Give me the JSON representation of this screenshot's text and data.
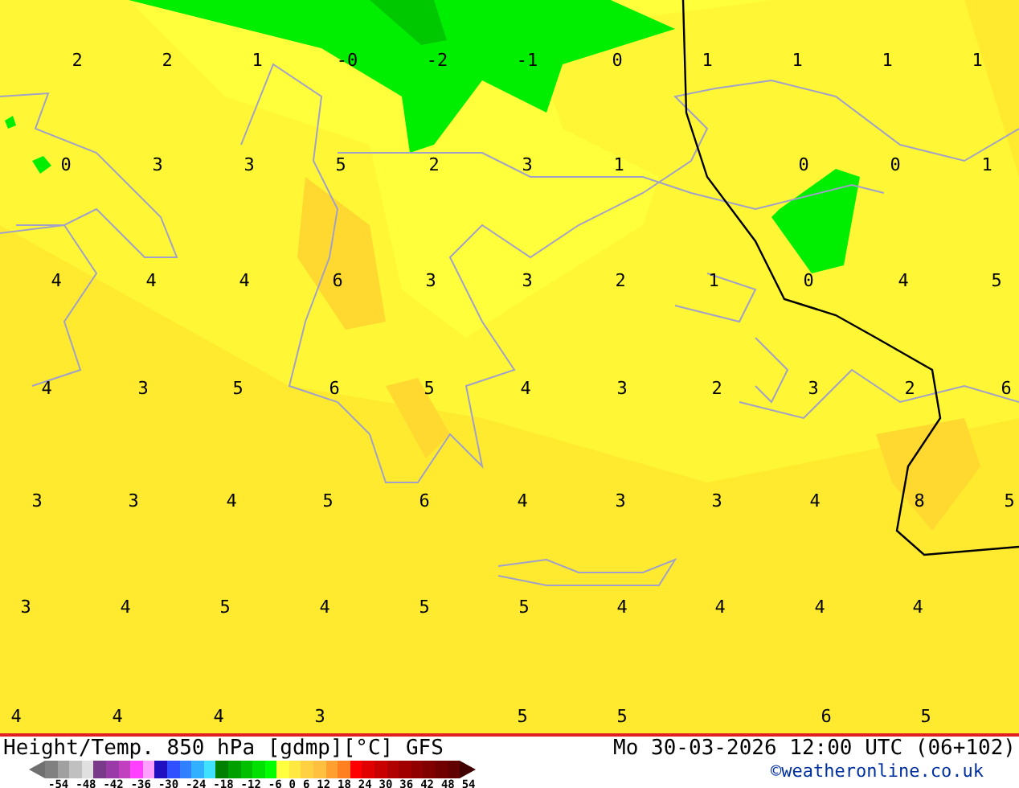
{
  "map": {
    "value_rows": [
      [
        "2",
        "2",
        "1",
        "-0",
        "-2",
        "-1",
        "0",
        "1",
        "1",
        "1",
        "1"
      ],
      [
        "0",
        "3",
        "3",
        "5",
        "2",
        "3",
        "1",
        "0",
        "0",
        "1"
      ],
      [
        "4",
        "4",
        "4",
        "6",
        "3",
        "3",
        "2",
        "1",
        "0",
        "4",
        "5"
      ],
      [
        "4",
        "3",
        "5",
        "6",
        "5",
        "4",
        "3",
        "2",
        "3",
        "2",
        "6"
      ],
      [
        "3",
        "3",
        "4",
        "5",
        "6",
        "4",
        "3",
        "3",
        "4",
        "8",
        "5"
      ],
      [
        "3",
        "4",
        "5",
        "4",
        "5",
        "5",
        "4",
        "4",
        "4",
        "4"
      ],
      [
        "4",
        "4",
        "4",
        "3",
        "5",
        "5",
        "6",
        "5"
      ]
    ]
  },
  "footer": {
    "title": "Height/Temp. 850 hPa [gdmp][°C] GFS",
    "datetime": "Mo 30-03-2026 12:00 UTC (06+102)",
    "credit": "©weatheronline.co.uk",
    "legend": {
      "swatches": [
        {
          "color": "#808080"
        },
        {
          "color": "#a0a0a0"
        },
        {
          "color": "#c0c0c0"
        },
        {
          "color": "#e0e0e0"
        },
        {
          "color": "#7a3a8a"
        },
        {
          "color": "#9a3aa8"
        },
        {
          "color": "#c040c0"
        },
        {
          "color": "#ff40ff"
        },
        {
          "color": "#ffa0ff"
        },
        {
          "color": "#2010c0"
        },
        {
          "color": "#3050ff"
        },
        {
          "color": "#3080ff"
        },
        {
          "color": "#30b0ff"
        },
        {
          "color": "#40e0ff"
        },
        {
          "color": "#008000"
        },
        {
          "color": "#00a000"
        },
        {
          "color": "#00c000"
        },
        {
          "color": "#00e000"
        },
        {
          "color": "#00ff00"
        },
        {
          "color": "#ffff40"
        },
        {
          "color": "#ffe840"
        },
        {
          "color": "#ffd040"
        },
        {
          "color": "#ffc040"
        },
        {
          "color": "#ffa030"
        },
        {
          "color": "#ff8020"
        },
        {
          "color": "#ff0000"
        },
        {
          "color": "#e00000"
        },
        {
          "color": "#c80000"
        },
        {
          "color": "#b00000"
        },
        {
          "color": "#a00000"
        },
        {
          "color": "#900000"
        },
        {
          "color": "#800000"
        },
        {
          "color": "#700000"
        },
        {
          "color": "#600000"
        }
      ],
      "ticks": [
        "-54",
        "-48",
        "-42",
        "-36",
        "-30",
        "-24",
        "-18",
        "-12",
        "-6",
        "0",
        "6",
        "12",
        "18",
        "24",
        "30",
        "36",
        "42",
        "48",
        "54"
      ]
    }
  }
}
